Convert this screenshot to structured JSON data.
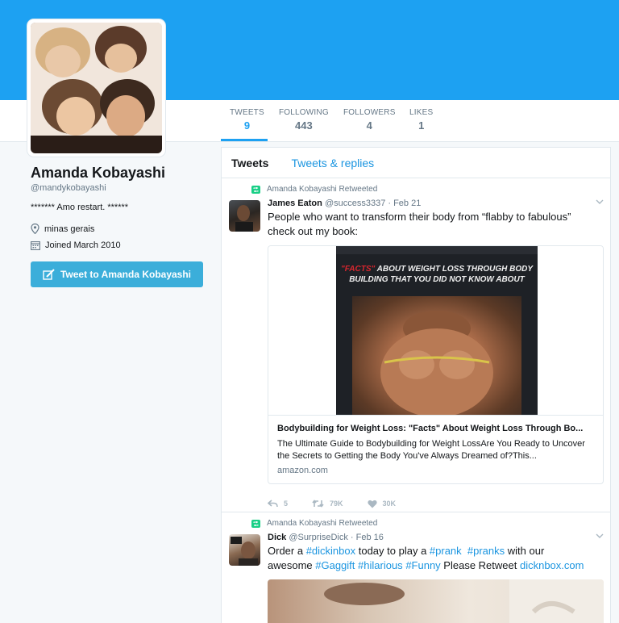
{
  "profile": {
    "name": "Amanda Kobayashi",
    "handle": "@mandykobayashi",
    "bio": "******* Amo restart. ******",
    "location": "minas gerais",
    "joined": "Joined March 2010",
    "tweet_to_label": "Tweet to Amanda Kobayashi"
  },
  "stats": [
    {
      "label": "TWEETS",
      "value": "9"
    },
    {
      "label": "FOLLOWING",
      "value": "443"
    },
    {
      "label": "FOLLOWERS",
      "value": "4"
    },
    {
      "label": "LIKES",
      "value": "1"
    }
  ],
  "tabs": {
    "tweets": "Tweets",
    "replies": "Tweets & replies"
  },
  "tweets": [
    {
      "retweet_text": "Amanda Kobayashi Retweeted",
      "name": "James Eaton",
      "meta": "@success3337 · Feb 21",
      "text_1": "People who want to transform their body from “flabby to fabulous”",
      "text_2": "check out my book:",
      "card": {
        "book_line1_red": "\"FACTS\"",
        "book_line1": " ABOUT WEIGHT LOSS THROUGH BODY",
        "book_line2": "BUILDING THAT YOU DID NOT KNOW ABOUT",
        "title": "Bodybuilding for Weight Loss: \"Facts\" About Weight Loss Through Bo...",
        "desc": "The Ultimate Guide to Bodybuilding for Weight LossAre You Ready to Uncover the Secrets to Getting the Body You've Always Dreamed of?This...",
        "domain": "amazon.com"
      },
      "replies": "5",
      "retweets": "79K",
      "likes": "30K"
    },
    {
      "retweet_text": "Amanda Kobayashi Retweeted",
      "name": "Dick",
      "meta": "@SurpriseDick · Feb 16",
      "t1": "Order a ",
      "h1": "#dickinbox",
      "t2": " today to play a ",
      "h2": "#prank",
      "t3": "  ",
      "h3": "#pranks",
      "t4": " with our",
      "t5": "awesome ",
      "h4": "#Gaggift",
      "t6": " ",
      "h5": "#hilarious",
      "t7": " ",
      "h6": "#Funny",
      "t8": " Please Retweet ",
      "h7": "dicknbox.com"
    }
  ],
  "colors": {
    "accent": "#1da1f2",
    "retweet": "#19cf86",
    "link": "#1b95e0"
  }
}
